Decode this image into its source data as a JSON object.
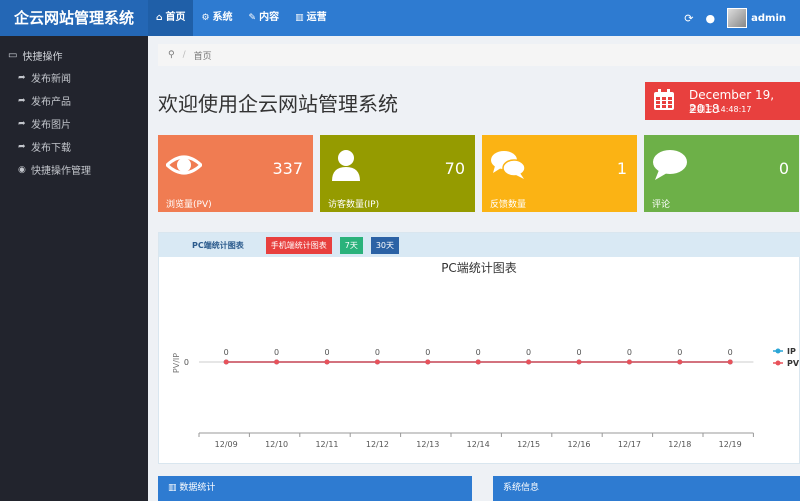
{
  "app": {
    "brand": "企云网站管理系统"
  },
  "topnav": [
    {
      "icon": "home-icon",
      "glyph": "⌂",
      "label": "首页"
    },
    {
      "icon": "gears-icon",
      "glyph": "⚙",
      "label": "系统"
    },
    {
      "icon": "edit-icon",
      "glyph": "✎",
      "label": "内容"
    },
    {
      "icon": "bar-chart-icon",
      "glyph": "▥",
      "label": "运营"
    }
  ],
  "user": {
    "name": "admin"
  },
  "sidebar": {
    "heading": "快捷操作",
    "items": [
      {
        "label": "发布新闻",
        "icon": "share-icon"
      },
      {
        "label": "发布产品",
        "icon": "share-icon"
      },
      {
        "label": "发布图片",
        "icon": "share-icon"
      },
      {
        "label": "发布下载",
        "icon": "share-icon"
      },
      {
        "label": "快捷操作管理",
        "icon": "eye-icon"
      }
    ]
  },
  "breadcrumb": {
    "home": "首页"
  },
  "page": {
    "title": "欢迎使用企云网站管理系统"
  },
  "date": {
    "line1": "December 19, 2018",
    "line2": "星期三  14:48:17"
  },
  "stats": [
    {
      "value": "337",
      "label": "浏览量(PV)",
      "color": "#f07c52"
    },
    {
      "value": "70",
      "label": "访客数量(IP)",
      "color": "#959b00"
    },
    {
      "value": "1",
      "label": "反馈数量",
      "color": "#fbb314"
    },
    {
      "value": "0",
      "label": "评论",
      "color": "#6db048"
    }
  ],
  "chart_tabs": {
    "pc": "PC端统计图表",
    "mobile": "手机端统计图表",
    "d7": "7天",
    "d30": "30天"
  },
  "chart_data": {
    "type": "line",
    "title": "PC端统计图表",
    "ylabel": "PV/IP",
    "x": [
      "12/09",
      "12/10",
      "12/11",
      "12/12",
      "12/13",
      "12/14",
      "12/15",
      "12/16",
      "12/17",
      "12/18",
      "12/19"
    ],
    "y_ticks": [
      "0"
    ],
    "series": [
      {
        "name": "IP",
        "color": "#2ba6d6",
        "values": [
          0,
          0,
          0,
          0,
          0,
          0,
          0,
          0,
          0,
          0,
          0
        ]
      },
      {
        "name": "PV",
        "color": "#e8525a",
        "values": [
          0,
          0,
          0,
          0,
          0,
          0,
          0,
          0,
          0,
          0,
          0
        ]
      }
    ],
    "legend": "right"
  },
  "panels": {
    "data_stats": "数据统计",
    "system_info": "系统信息"
  }
}
